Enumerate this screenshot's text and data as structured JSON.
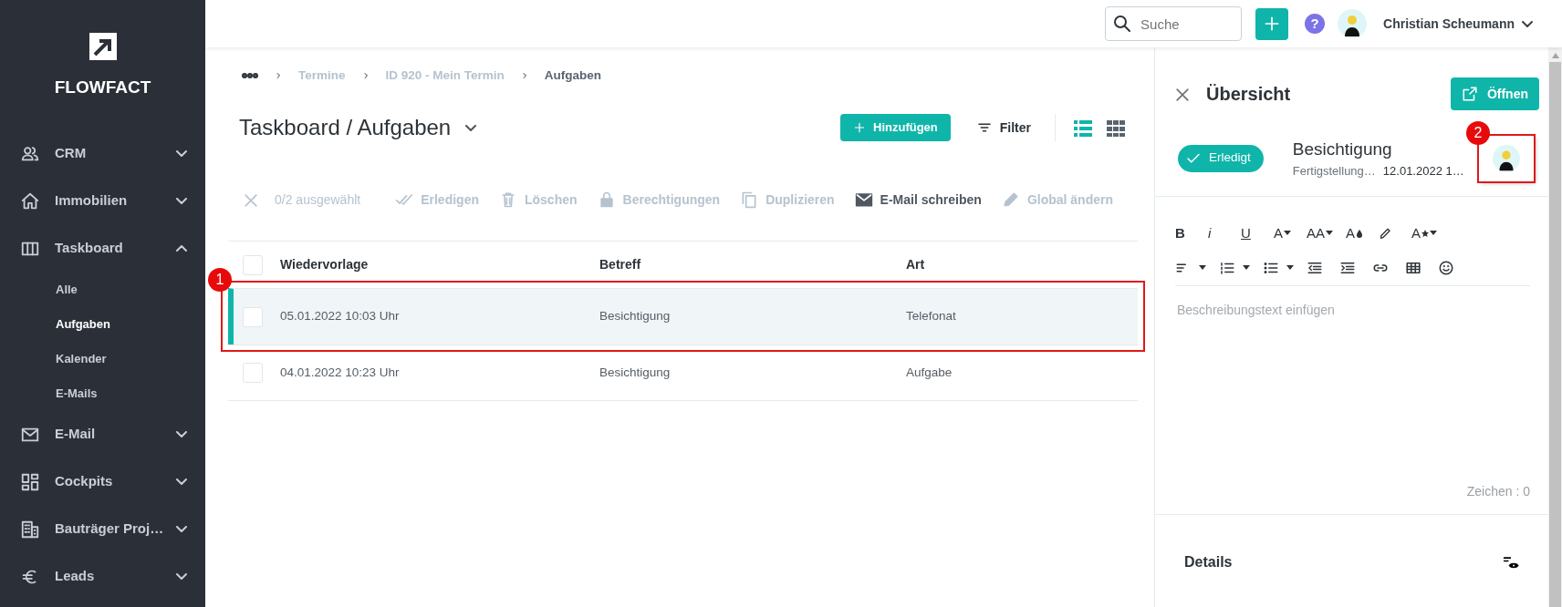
{
  "sidebar": {
    "logo_text": "FLOWFACT",
    "items": [
      {
        "label": "CRM",
        "expanded": false
      },
      {
        "label": "Immobilien",
        "expanded": false
      },
      {
        "label": "Taskboard",
        "expanded": true,
        "children": [
          {
            "label": "Alle",
            "selected": false
          },
          {
            "label": "Aufgaben",
            "selected": true
          },
          {
            "label": "Kalender",
            "selected": false
          },
          {
            "label": "E-Mails",
            "selected": false
          }
        ]
      },
      {
        "label": "E-Mail",
        "expanded": false
      },
      {
        "label": "Cockpits",
        "expanded": false
      },
      {
        "label": "Bauträger Proj…",
        "expanded": false
      },
      {
        "label": "Leads",
        "expanded": false
      }
    ]
  },
  "topbar": {
    "search": {
      "placeholder": "Suche"
    },
    "help_label": "?",
    "user_name": "Christian Scheumann"
  },
  "breadcrumb": [
    "Termine",
    "ID 920 - Mein Termin",
    "Aufgaben"
  ],
  "page_title": "Taskboard / Aufgaben",
  "add_button": "Hinzufügen",
  "filter_button": "Filter",
  "views": [
    {
      "selected": true
    },
    {
      "selected": false
    }
  ],
  "action_bar": {
    "selection_count": "0/2 ausgewählt",
    "actions": [
      {
        "label": "Erledigen",
        "disabled": true
      },
      {
        "label": "Löschen",
        "disabled": true
      },
      {
        "label": "Berechtigungen",
        "disabled": true
      },
      {
        "label": "Duplizieren",
        "disabled": true
      },
      {
        "label": "E-Mail schreiben",
        "disabled": false
      },
      {
        "label": "Global ändern",
        "disabled": true
      }
    ]
  },
  "table": {
    "select_all_checked": false,
    "columns": [
      "Wiedervorlage",
      "Betreff",
      "Art"
    ],
    "rows": [
      {
        "selected": true,
        "checked": false,
        "callout": "1",
        "cells": [
          "05.01.2022 10:03 Uhr",
          "Besichtigung",
          "Telefonat"
        ]
      },
      {
        "selected": false,
        "checked": false,
        "cells": [
          "04.01.2022 10:23 Uhr",
          "Besichtigung",
          "Aufgabe"
        ]
      }
    ]
  },
  "panel": {
    "title": "Übersicht",
    "open_button": "Öffnen",
    "status": "Erledigt",
    "task_title": "Besichtigung",
    "subtitle_label": "Fertigstellung…",
    "subtitle_value": "12.01.2022 1…",
    "avatar_callout": "2",
    "format_labels": [
      "B",
      "i",
      "U",
      "A",
      "AA",
      "A",
      "A"
    ],
    "editor_placeholder": "Beschreibungstext einfügen",
    "char_count": "Zeichen : 0",
    "details_title": "Details"
  }
}
